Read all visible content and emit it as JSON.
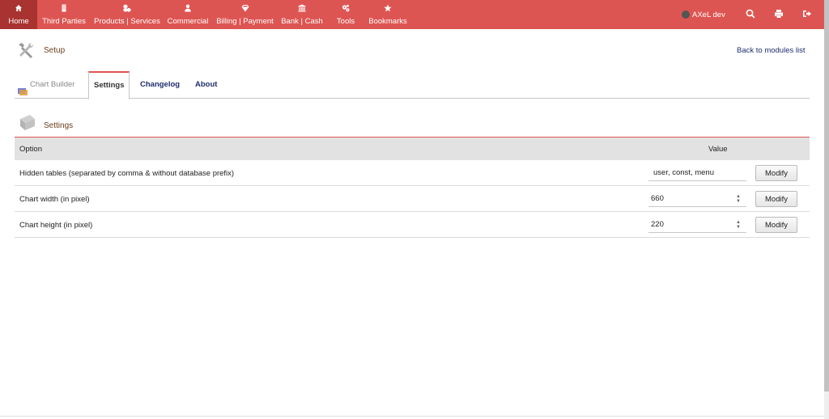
{
  "menu": [
    {
      "label": "Home",
      "icon": "home-icon",
      "active": true
    },
    {
      "label": "Third Parties",
      "icon": "building-icon"
    },
    {
      "label": "Products | Services",
      "icon": "cubes-icon"
    },
    {
      "label": "Commercial",
      "icon": "user-tie-icon"
    },
    {
      "label": "Billing | Payment",
      "icon": "diamond-icon"
    },
    {
      "label": "Bank | Cash",
      "icon": "bank-icon"
    },
    {
      "label": "Tools",
      "icon": "cogs-icon"
    },
    {
      "label": "Bookmarks",
      "icon": "star-icon"
    }
  ],
  "user": {
    "name": "AXeL dev"
  },
  "header": {
    "title": "Setup",
    "back_link": "Back to modules list"
  },
  "tabs": [
    {
      "label": "Chart Builder",
      "state": "inactive"
    },
    {
      "label": "Settings",
      "state": "active"
    },
    {
      "label": "Changelog",
      "state": "link"
    },
    {
      "label": "About",
      "state": "link"
    }
  ],
  "section": {
    "title": "Settings"
  },
  "table": {
    "col_option": "Option",
    "col_value": "Value",
    "rows": [
      {
        "label": "Hidden tables (separated by comma & without database prefix)",
        "value": "user, const, menu",
        "button": "Modify"
      },
      {
        "label": "Chart width (in pixel)",
        "value": "660",
        "button": "Modify"
      },
      {
        "label": "Chart height (in pixel)",
        "value": "220",
        "button": "Modify"
      }
    ]
  },
  "colors": {
    "accent": "#dd5552",
    "active_menu": "#a83330",
    "link": "#1e2d6e",
    "title": "#6b3d1d"
  }
}
